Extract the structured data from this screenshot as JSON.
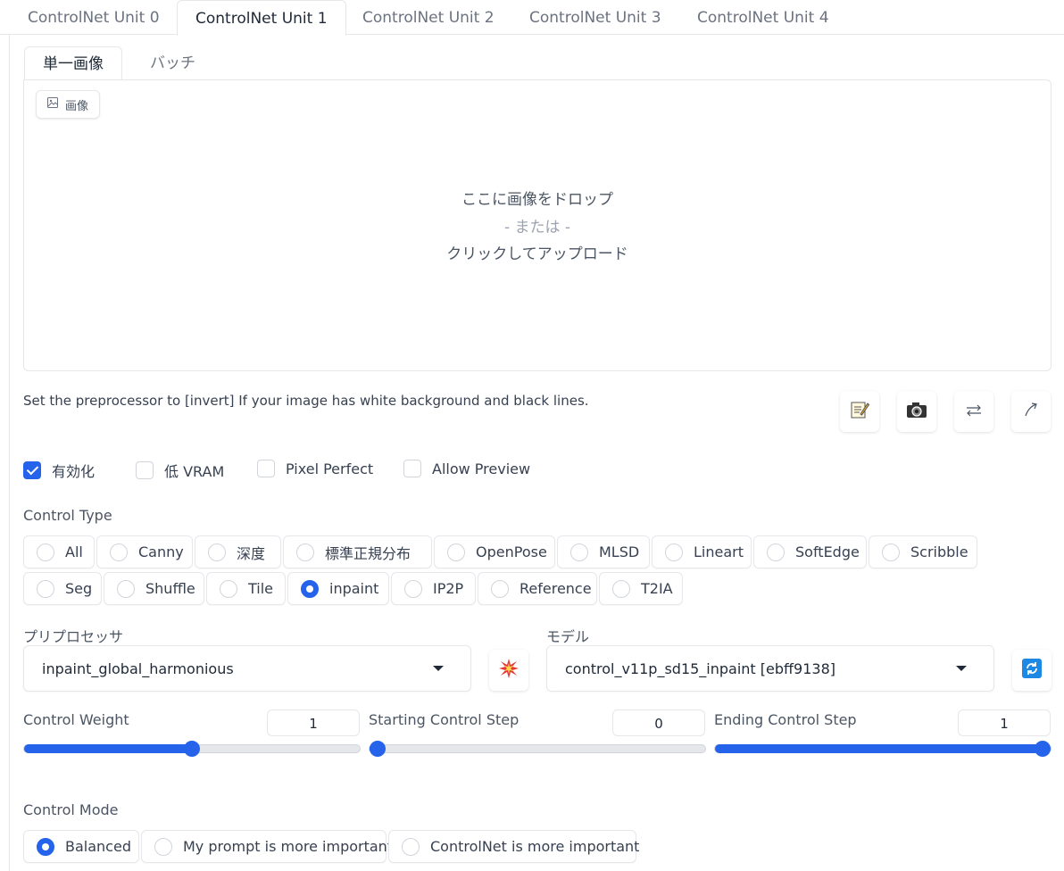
{
  "unit_tabs": [
    "ControlNet Unit 0",
    "ControlNet Unit 1",
    "ControlNet Unit 2",
    "ControlNet Unit 3",
    "ControlNet Unit 4"
  ],
  "active_unit": "ControlNet Unit 1",
  "image_tabs": [
    "単一画像",
    "バッチ"
  ],
  "image_label": "画像",
  "drop": {
    "line1": "ここに画像をドロップ",
    "line2": "- または -",
    "line3": "クリックしてアップロード"
  },
  "hint": "Set the preprocessor to [invert] If your image has white background and black lines.",
  "tool_icons": [
    "memo-icon",
    "camera-icon",
    "swap-arrows-icon",
    "curved-arrow-icon"
  ],
  "checkboxes": [
    {
      "label": "有効化",
      "checked": true
    },
    {
      "label": "低 VRAM",
      "checked": false
    },
    {
      "label": "Pixel Perfect",
      "checked": false
    },
    {
      "label": "Allow Preview",
      "checked": false
    }
  ],
  "control_type": {
    "label": "Control Type",
    "options": [
      "All",
      "Canny",
      "深度",
      "標準正規分布",
      "OpenPose",
      "MLSD",
      "Lineart",
      "SoftEdge",
      "Scribble",
      "Seg",
      "Shuffle",
      "Tile",
      "inpaint",
      "IP2P",
      "Reference",
      "T2IA"
    ],
    "selected": "inpaint"
  },
  "preprocessor": {
    "label": "プリプロセッサ",
    "value": "inpaint_global_harmonious"
  },
  "model": {
    "label": "モデル",
    "value": "control_v11p_sd15_inpaint [ebff9138]"
  },
  "sliders": {
    "weight": {
      "label": "Control Weight",
      "value": "1",
      "fraction": 0.5
    },
    "start": {
      "label": "Starting Control Step",
      "value": "0",
      "fraction": 0.0
    },
    "end": {
      "label": "Ending Control Step",
      "value": "1",
      "fraction": 1.0
    }
  },
  "control_mode": {
    "label": "Control Mode",
    "options": [
      "Balanced",
      "My prompt is more important",
      "ControlNet is more important"
    ],
    "selected": "Balanced"
  },
  "colors": {
    "accent": "#2563eb",
    "border": "#e5e7eb"
  }
}
